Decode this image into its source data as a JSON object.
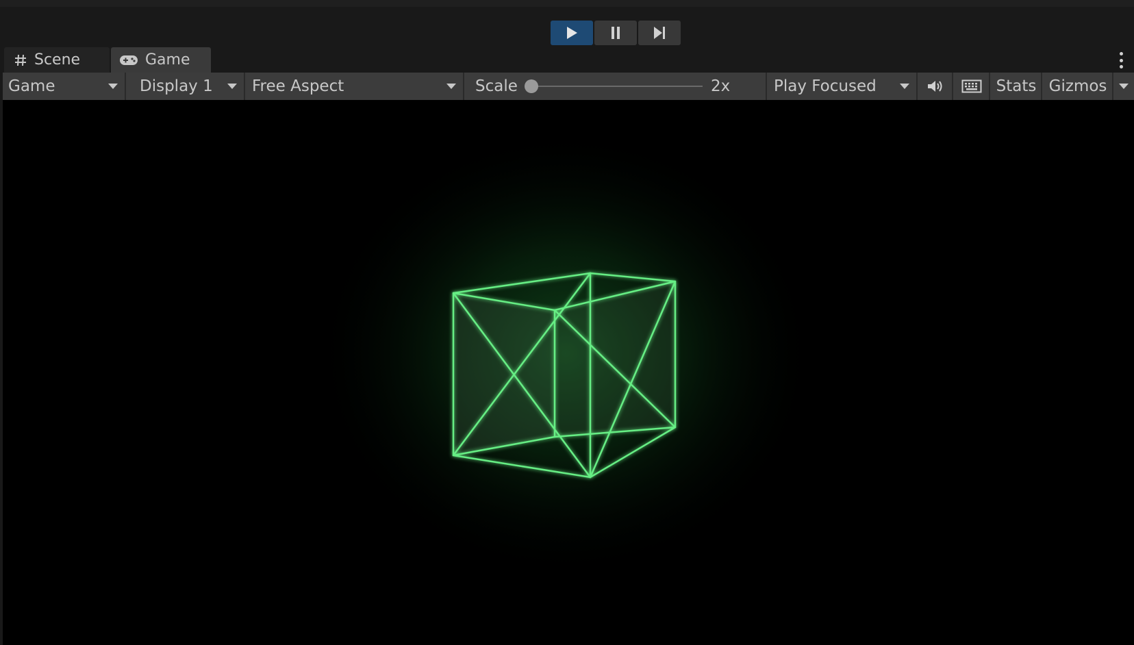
{
  "playbar": {
    "play_icon": "play-icon",
    "pause_icon": "pause-icon",
    "step_icon": "step-icon",
    "active_color": "#1e4a74"
  },
  "tabs": [
    {
      "label": "Scene",
      "icon": "grid-hash-icon"
    },
    {
      "label": "Game",
      "icon": "gamepad-icon"
    }
  ],
  "toolbar": {
    "view_mode": "Game",
    "display": "Display 1",
    "aspect": "Free Aspect",
    "scale_label": "Scale",
    "scale_value": "2x",
    "play_mode": "Play Focused",
    "mute_icon": "speaker-icon",
    "keyboard_icon": "keyboard-icon",
    "stats_label": "Stats",
    "gizmos_label": "Gizmos"
  },
  "scene": {
    "object": "wireframe-cube",
    "line_color": "#5ee37a",
    "glow_color": "#1c7a30"
  }
}
